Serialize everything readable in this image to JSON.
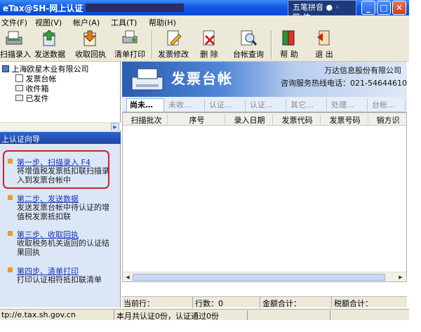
{
  "window": {
    "title": "eTax@SH-网上认证",
    "ime": {
      "name": "五笔拼音",
      "mode": "简 体"
    }
  },
  "menu": {
    "file": "文件(F)",
    "view": "视图(V)",
    "account": "帐户(A)",
    "tools": "工具(T)",
    "help": "帮助(H)"
  },
  "toolbar": {
    "scan_entry": "扫描录入",
    "send_data": "发送数据",
    "receive_receipt": "收取回执",
    "print_list": "清单打印",
    "modify_invoice": "发票修改",
    "delete": "删 除",
    "ledger_query": "台帐查询",
    "help": "帮 助",
    "exit": "退 出"
  },
  "tree": {
    "company": "上海欧星木业有限公司",
    "items": [
      "发票台帐",
      "收件箱",
      "已发件"
    ]
  },
  "wizard": {
    "header": "上认证向导",
    "steps": [
      {
        "title": "第一步、扫描录入  F4",
        "desc": "将增值税发票抵扣联扫描录入到发票台帐中"
      },
      {
        "title": "第二步、发送数据",
        "desc": "发送发票台帐中待认证的增值税发票抵扣联"
      },
      {
        "title": "第三步、收取回执",
        "desc": "收取税务机关返回的认证结果回执"
      },
      {
        "title": "第四步、清单打印",
        "desc": "打印认证相符抵扣联清单"
      }
    ]
  },
  "banner": {
    "title": "发票台帐",
    "company": "万达信息股份有限公司",
    "hotline": "咨询服务热线电话：021-54644610"
  },
  "tabs": [
    "尚未…",
    "未收…",
    "认证…",
    "认证…",
    "其它…",
    "处理…",
    "台帐…"
  ],
  "grid": {
    "columns": [
      "扫描批次",
      "序号",
      "录入日期",
      "发票代码",
      "发票号码",
      "销方识"
    ]
  },
  "summary": {
    "current_row": "当前行：",
    "row_count": "行数：0",
    "amount_total": "金额合计：",
    "tax_total": "税额合计："
  },
  "status": {
    "url": "tp://e.tax.sh.gov.cn",
    "message": "本月共认证0份，认证通过0份"
  },
  "colors": {
    "titlebar": "#1159e6",
    "wizard_bg": "#dbe6f7",
    "step_bullet": "#f29a1a",
    "highlight": "#c8242b"
  }
}
